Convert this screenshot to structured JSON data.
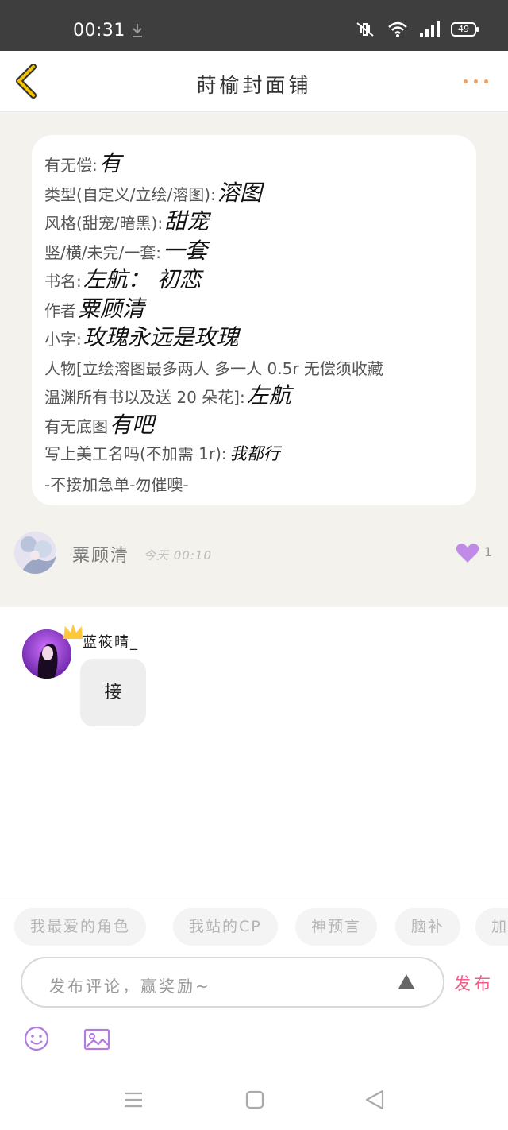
{
  "status_bar": {
    "time": "00:31",
    "battery": "49"
  },
  "header": {
    "title": "莳榆封面铺"
  },
  "post": {
    "lines": [
      {
        "label": "有无偿:",
        "answer": "有"
      },
      {
        "label": "类型(自定义/立绘/溶图):",
        "answer": "溶图"
      },
      {
        "label": "风格(甜宠/暗黑):",
        "answer": "甜宠"
      },
      {
        "label": "竖/横/未完/一套:",
        "answer": "一套"
      },
      {
        "label": "书名:",
        "answer": "左航：  初恋"
      },
      {
        "label": "作者",
        "answer": "粟顾清"
      },
      {
        "label": "小字:",
        "answer": "玫瑰永远是玫瑰"
      },
      {
        "label": "人物[立绘溶图最多两人 多一人 0.5r 无偿须收藏",
        "answer": ""
      },
      {
        "label": "温渊所有书以及送 20 朵花]:",
        "answer": "左航"
      },
      {
        "label": "有无底图",
        "answer": "有吧"
      },
      {
        "label": "写上美工名吗(不加需 1r):",
        "answer": "我都行"
      },
      {
        "label": "-不接加急单-勿催噢-",
        "answer": ""
      }
    ],
    "author": {
      "name": "粟顾清",
      "time": "今天 00:10"
    },
    "likes": "1"
  },
  "comment": {
    "name": "蓝筱晴_",
    "text": "接"
  },
  "tags": [
    "我最爱的角色",
    "我站的CP",
    "神预言",
    "脑补",
    "加"
  ],
  "input": {
    "placeholder": "发布评论，赢奖励~",
    "publish_label": "发布"
  },
  "colors": {
    "accent": "#f25e88",
    "like": "#c08ae8",
    "back": "#f2c100",
    "more": "#f0a060"
  }
}
